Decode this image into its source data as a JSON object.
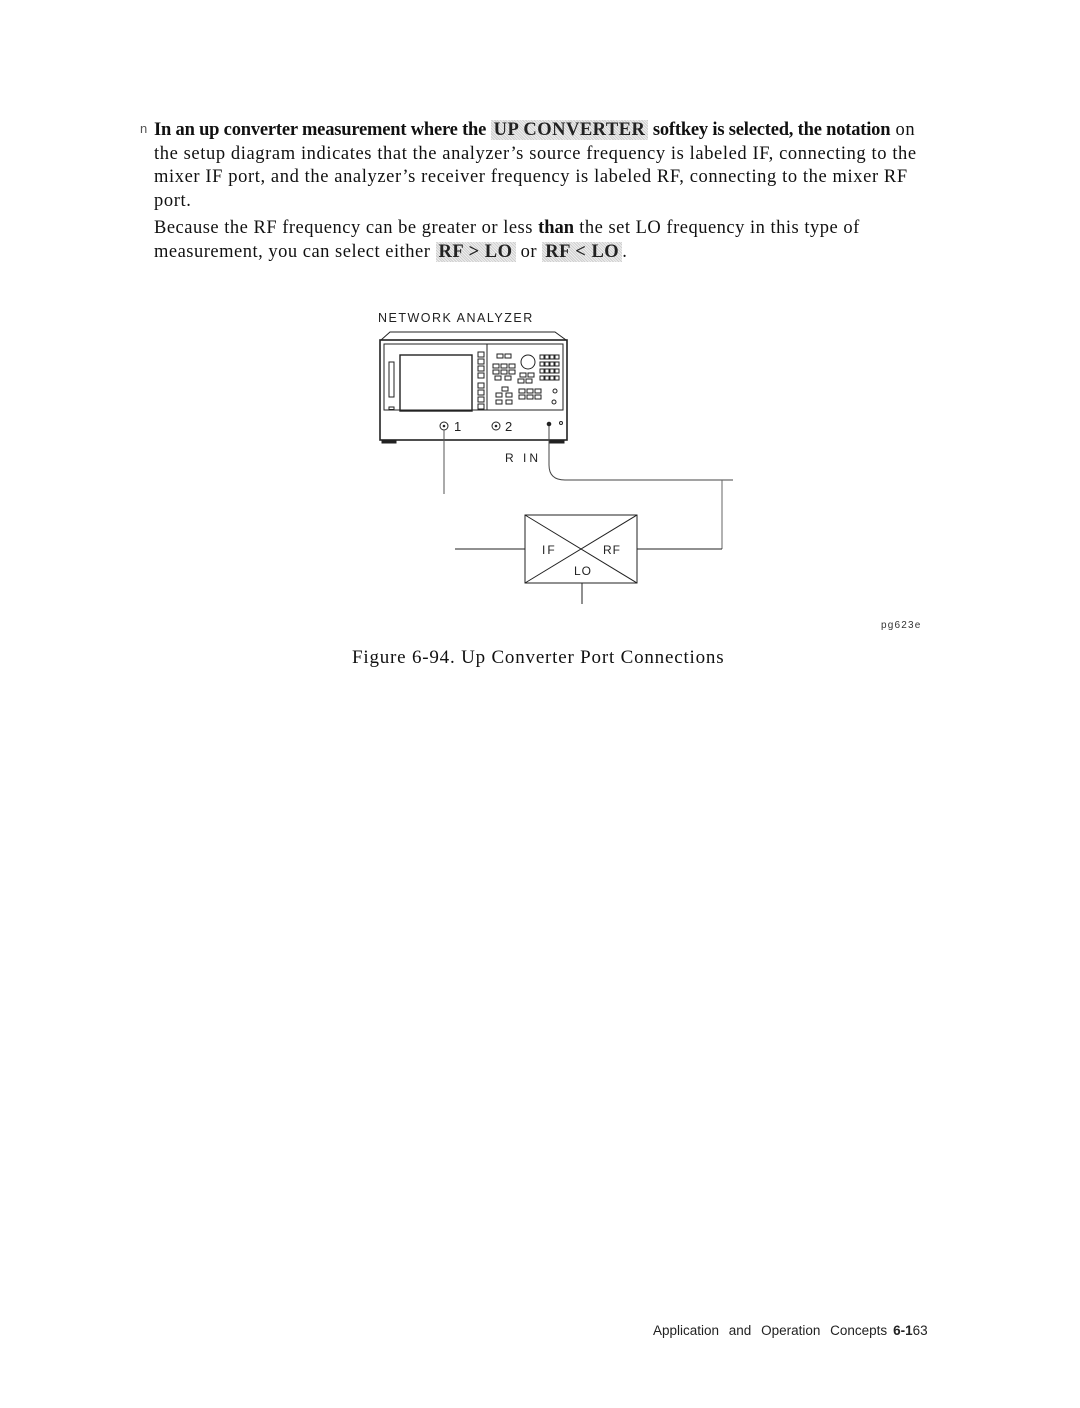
{
  "bullet": {
    "marker": "n",
    "lead_before": "In an up converter measurement where the ",
    "softkey": "UP CONVERTER",
    "lead_after": " softkey is selected, the notation",
    "body": " on the setup diagram indicates that the analyzer’s source frequency is labeled IF, connecting to the mixer IF port, and the analyzer’s receiver frequency is labeled RF, connecting to the mixer RF port."
  },
  "para2": {
    "text_a": "Because the RF frequency can be greater or less ",
    "bold": "than",
    "text_b": " the set LO frequency in this type of measurement, you can select either ",
    "softkey1": "RF > LO",
    "or": " or ",
    "softkey2": "RF < LO",
    "end": "."
  },
  "diagram": {
    "analyzer_label": "NETWORK ANALYZER",
    "port1_label": "1",
    "port2_label": "2",
    "rin_label": "R IN",
    "mixer": {
      "if_label": "IF",
      "rf_label": "RF",
      "lo_label": "LO"
    },
    "figure_id": "pg623e"
  },
  "caption": "Figure 6-94. Up Converter Port Connections",
  "footer": {
    "section": "Application and Operation Concepts",
    "page_prefix": "6-1",
    "page_suffix": "63"
  }
}
